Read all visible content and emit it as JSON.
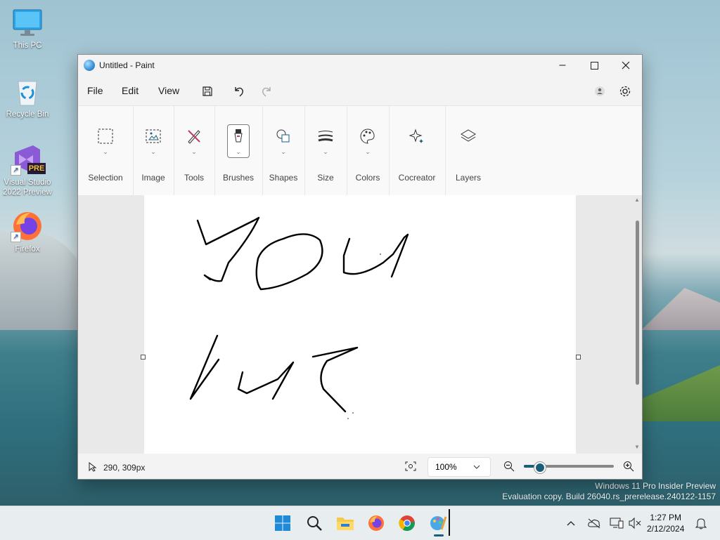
{
  "desktop": {
    "icons": [
      {
        "label": "This PC"
      },
      {
        "label": "Recycle Bin"
      },
      {
        "label": "Visual Studio 2022 Preview",
        "badge": "PRE"
      },
      {
        "label": "Firefox"
      }
    ],
    "watermark": {
      "line1": "Windows 11 Pro Insider Preview",
      "line2": "Evaluation copy. Build 26040.rs_prerelease.240122-1157"
    }
  },
  "window": {
    "title": "Untitled - Paint",
    "controls": {
      "minimize": "–",
      "maximize": "☐",
      "close": "✕"
    }
  },
  "menubar": {
    "items": [
      "File",
      "Edit",
      "View"
    ]
  },
  "ribbon": {
    "groups": [
      {
        "label": "Selection",
        "icon": "selection-icon"
      },
      {
        "label": "Image",
        "icon": "image-icon"
      },
      {
        "label": "Tools",
        "icon": "tools-icon"
      },
      {
        "label": "Brushes",
        "icon": "brush-icon"
      },
      {
        "label": "Shapes",
        "icon": "shapes-icon"
      },
      {
        "label": "Size",
        "icon": "size-icon"
      },
      {
        "label": "Colors",
        "icon": "palette-icon"
      },
      {
        "label": "Cocreator",
        "icon": "sparkle-icon"
      },
      {
        "label": "Layers",
        "icon": "layers-icon"
      }
    ]
  },
  "statusbar": {
    "coords": "290, 309px",
    "zoom": "100%",
    "zoom_level": 0.17
  },
  "taskbar": {
    "time": "1:27 PM",
    "date": "2/12/2024"
  },
  "colors": {
    "accent": "#1b5e7a",
    "ink": "#000000"
  }
}
